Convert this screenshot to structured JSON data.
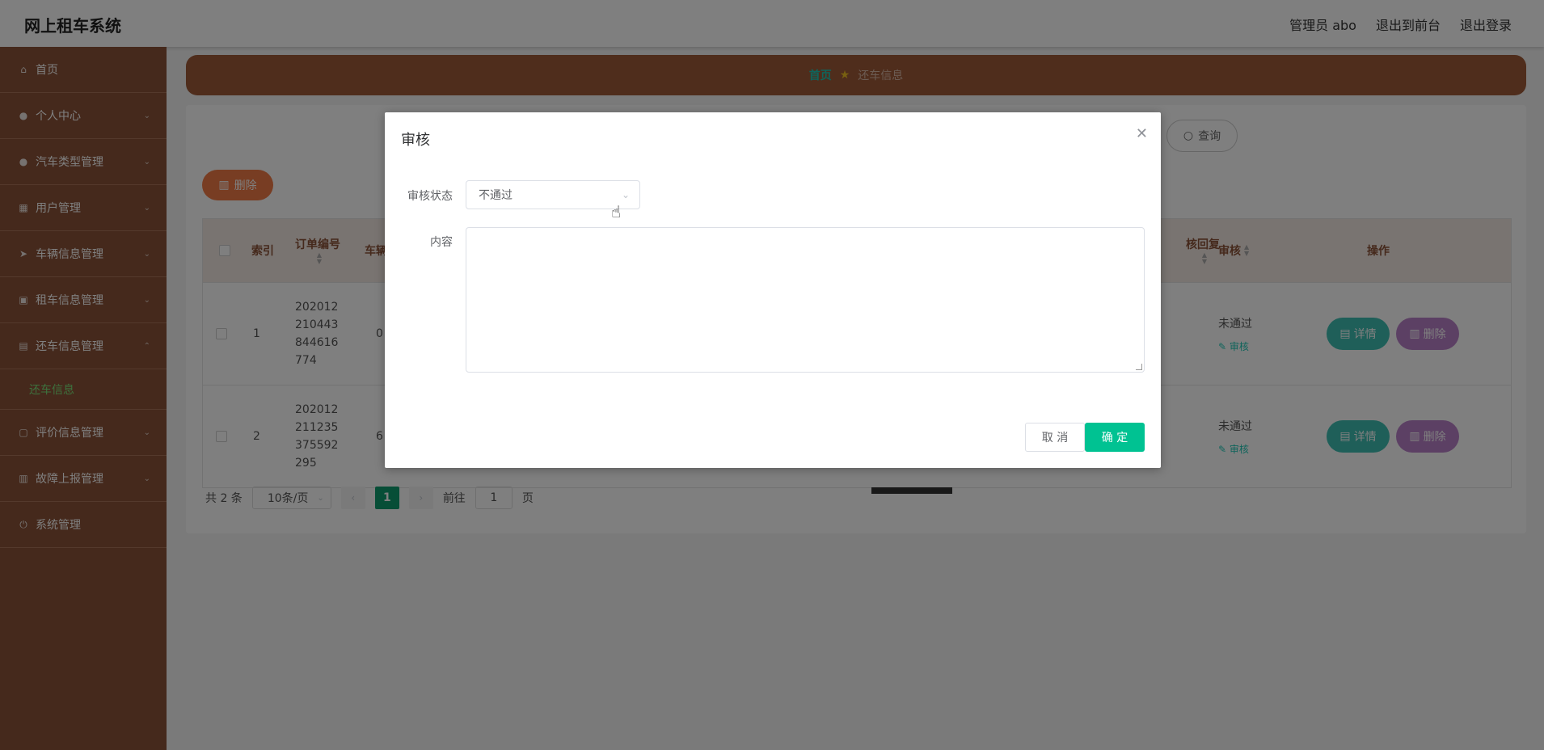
{
  "header": {
    "app_title": "网上租车系统",
    "admin_label": "管理员 abo",
    "frontend_link": "退出到前台",
    "logout_link": "退出登录"
  },
  "sidebar": {
    "items": [
      {
        "label": "首页",
        "icon": "home-icon"
      },
      {
        "label": "个人中心",
        "icon": "user-icon"
      },
      {
        "label": "汽车类型管理",
        "icon": "user-icon"
      },
      {
        "label": "用户管理",
        "icon": "table-icon"
      },
      {
        "label": "车辆信息管理",
        "icon": "send-icon"
      },
      {
        "label": "租车信息管理",
        "icon": "briefcase-icon"
      },
      {
        "label": "还车信息管理",
        "icon": "clipboard-icon"
      },
      {
        "label": "评价信息管理",
        "icon": "doc-icon"
      },
      {
        "label": "故障上报管理",
        "icon": "chart-icon"
      },
      {
        "label": "系统管理",
        "icon": "power-icon"
      }
    ],
    "sub_item": "还车信息"
  },
  "breadcrumb": {
    "home": "首页",
    "current": "还车信息"
  },
  "toolbar": {
    "query_label": "查询",
    "batch_delete_label": "删除"
  },
  "table": {
    "headers": {
      "index": "索引",
      "order_no": "订单编号",
      "car": "车辆",
      "reply": "核回复",
      "audit": "审核",
      "ops": "操作"
    },
    "rows": [
      {
        "index": "1",
        "order_no": "20201221044384461677​4",
        "order_no_display": "202012210443844616774",
        "car": "0",
        "audit_status": "未通过",
        "audit_link": "审核"
      },
      {
        "index": "2",
        "order_no": "202012211235375592295",
        "order_no_display": "202012211235375592295",
        "car": "6",
        "audit_status": "未通过",
        "audit_link": "审核"
      }
    ],
    "detail_label": "详情",
    "delete_label": "删除"
  },
  "pager": {
    "total": "共 2 条",
    "page_size": "10条/页",
    "current_page": "1",
    "goto_label": "前往",
    "goto_value": "1",
    "page_unit": "页"
  },
  "dialog": {
    "title": "审核",
    "status_label": "审核状态",
    "status_value": "不通过",
    "content_label": "内容",
    "cancel_label": "取 消",
    "ok_label": "确 定"
  }
}
